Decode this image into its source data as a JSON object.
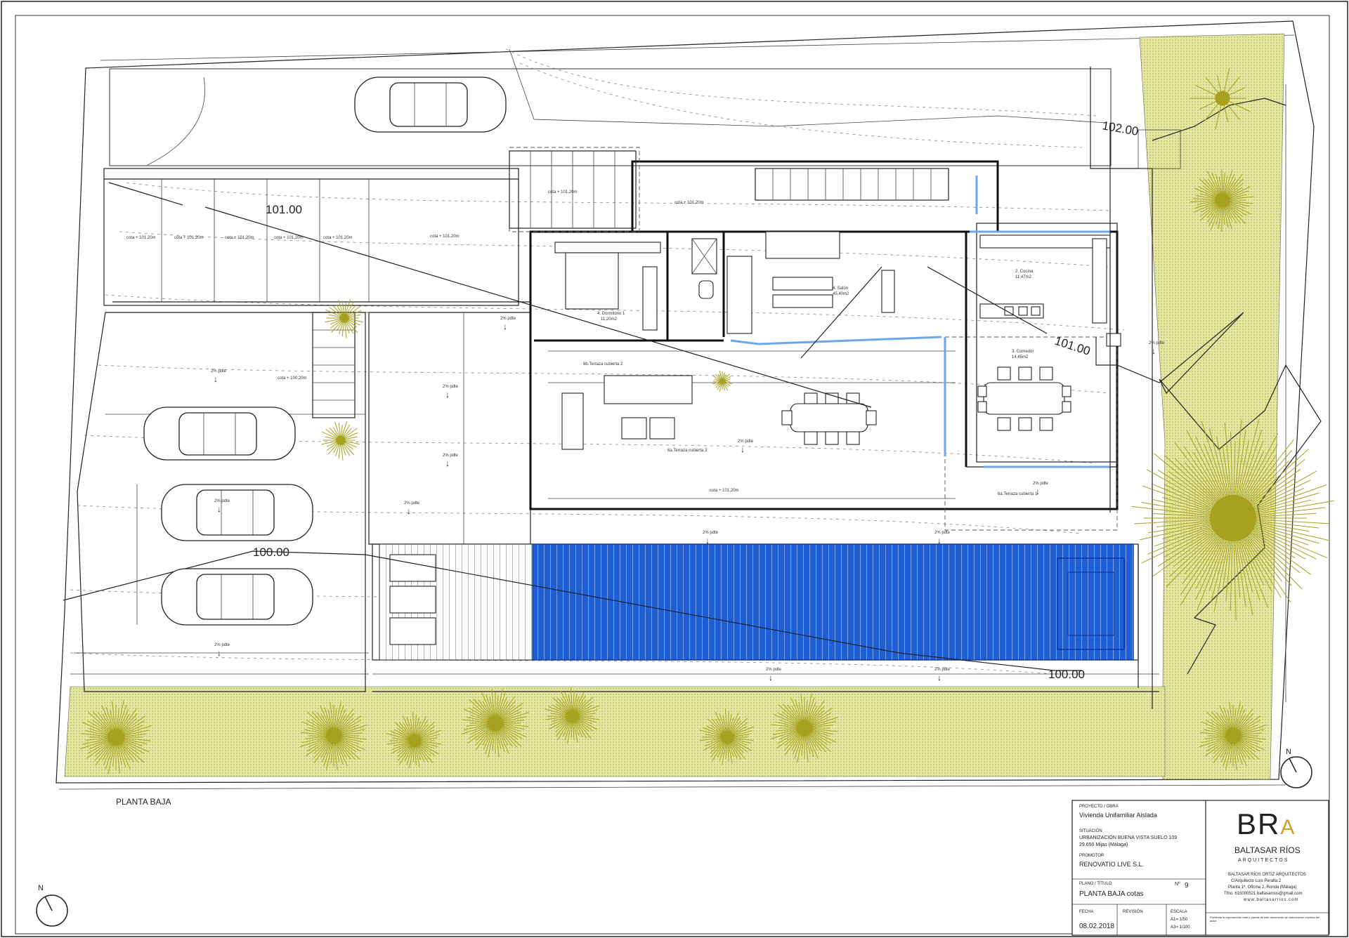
{
  "drawing": {
    "plan_label": "PLANTA BAJA",
    "levels": {
      "l102": "102.00",
      "l101_top": "101.00",
      "l101_right": "101.00",
      "l100_left": "100.00",
      "l100_pool": "100.00"
    },
    "north_top": "N",
    "north_bottom": "N",
    "slope_label": "2% pdte",
    "rooms": {
      "dorm": "4. Dormitorio 1",
      "dorm_area": "11,20m2",
      "salon": "4. Salón",
      "salon_area": "45,40m2",
      "cocina": "2. Cocina",
      "cocina_area": "11,47m2",
      "comedor": "3. Comedor",
      "comedor_area": "14,45m2",
      "terraza1": "6a.Terraza cubierta 1",
      "terraza2": "6b.Terraza cubierta 2",
      "terraza3": "6a.Terraza cubierta 3"
    },
    "cotas": [
      "cota + 101,20m",
      "cota + 101,20m",
      "cota + 101,20m",
      "cota + 101,20m",
      "cota + 101,20m",
      "cota + 101,20m",
      "cota + 100,20m",
      "cota + 101,20m",
      "cota + 101,20m",
      "cota + 101,20m"
    ]
  },
  "title_block": {
    "project_label": "PROYECTO / OBRA",
    "project": "Vivienda Unifamiliar Aislada",
    "situation_label": "SITUACIÓN",
    "situation_line1": "URBANIZACIÓN BUENA VISTA SUELO 109",
    "situation_line2": "29.650 Mijas (Málaga)",
    "promoter_label": "PROMOTOR",
    "promoter": "RENOVATIO LIVE S.L.",
    "plan_label": "PLANO / TÍTULO",
    "plan_no_label": "Nº",
    "plan_no": "9",
    "plan_title": "PLANTA BAJA cotas",
    "date_label": "FECHA",
    "date": "08.02.2018",
    "revision_label": "REVISIÓN",
    "scale_label": "ESCALA",
    "scale1": "A1= 1/50",
    "scale2": "A3= 1/100",
    "logo_letters": "BR",
    "logo_accent": "A",
    "firm_name": "BALTASAR RÍOS",
    "firm_sub": "ARQUITECTOS",
    "firm_full": "BALTASAR RÍOS ORTIZ  ARQUITECTOS",
    "firm_addr1": "C/Arquitecto Luis Peralta 2",
    "firm_addr2": "Planta 1ª, Oficina 2, Ronda (Málaga)",
    "firm_contact": "Tfno. 615000521  baltasarrios@gmail.com",
    "firm_web": "www.baltasarrios.com",
    "disclaimer": "Prohibida la reproducción total o parcial de este documento sin autorización expresa del autor"
  },
  "colors": {
    "pool": "#1e5fd6",
    "garden": "#d9dd8c",
    "tree": "#a6a11f",
    "line": "#222222"
  }
}
